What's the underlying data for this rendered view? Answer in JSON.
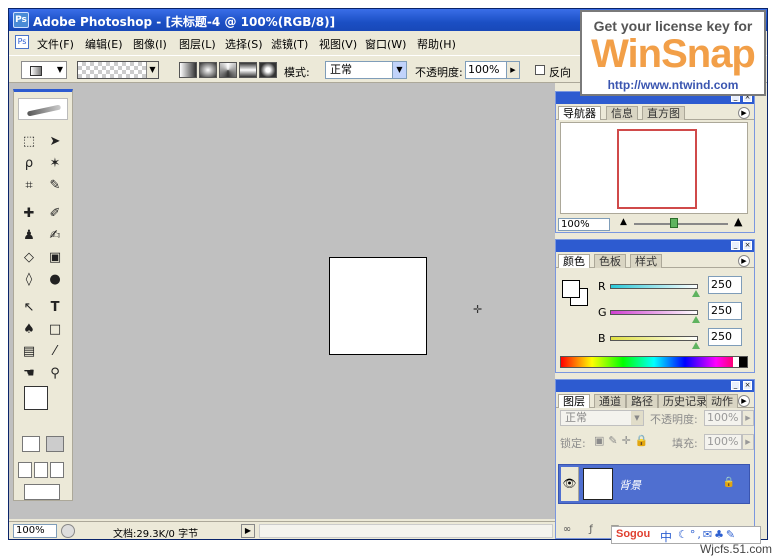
{
  "window": {
    "title": "Adobe Photoshop - [未标题-4 @ 100%(RGB/8)]",
    "app_icon": "photoshop-logo-icon"
  },
  "menu": [
    "文件(F)",
    "编辑(E)",
    "图像(I)",
    "图层(L)",
    "选择(S)",
    "滤镜(T)",
    "视图(V)",
    "窗口(W)",
    "帮助(H)"
  ],
  "options": {
    "mode_label": "模式:",
    "mode_value": "正常",
    "opacity_label": "不透明度:",
    "opacity_value": "100%",
    "reverse_label": "反向"
  },
  "promo": {
    "line1": "Get your license key for",
    "logo": "WinSnap",
    "url": "http://www.ntwind.com"
  },
  "toolbox": {
    "tools": [
      "marquee-tool",
      "move-tool",
      "lasso-tool",
      "magic-wand-tool",
      "crop-tool",
      "slice-tool",
      "healing-brush-tool",
      "brush-tool",
      "stamp-tool",
      "history-brush-tool",
      "eraser-tool",
      "gradient-tool",
      "blur-tool",
      "dodge-tool",
      "path-selection-tool",
      "type-tool",
      "pen-tool",
      "rectangle-tool",
      "notes-tool",
      "eyedropper-tool",
      "hand-tool",
      "zoom-tool"
    ]
  },
  "navigator": {
    "tabs": [
      "导航器",
      "信息",
      "直方图"
    ],
    "zoom": "100%"
  },
  "color": {
    "tabs": [
      "颜色",
      "色板",
      "样式"
    ],
    "channels": [
      {
        "label": "R",
        "value": "250",
        "color": "#2ac8d8"
      },
      {
        "label": "G",
        "value": "250",
        "color": "#d040d0"
      },
      {
        "label": "B",
        "value": "250",
        "color": "#e0e040"
      }
    ]
  },
  "layers": {
    "tabs": [
      "图层",
      "通道",
      "路径",
      "历史记录",
      "动作"
    ],
    "blend_mode": "正常",
    "opacity_label": "不透明度:",
    "opacity_value": "100%",
    "lock_label": "锁定:",
    "fill_label": "填充:",
    "fill_value": "100%",
    "layer_name": "背景"
  },
  "status": {
    "zoom": "100%",
    "doc_info": "文档:29.3K/0 字节"
  },
  "ime": {
    "logo": "Sogou",
    "mode": "中"
  },
  "watermark": "Wjcfs.51.com",
  "colors": {
    "titlebar": "#2d5bd0",
    "layer_selected": "#4f6fd0",
    "promo_orange": "#f29f48"
  }
}
